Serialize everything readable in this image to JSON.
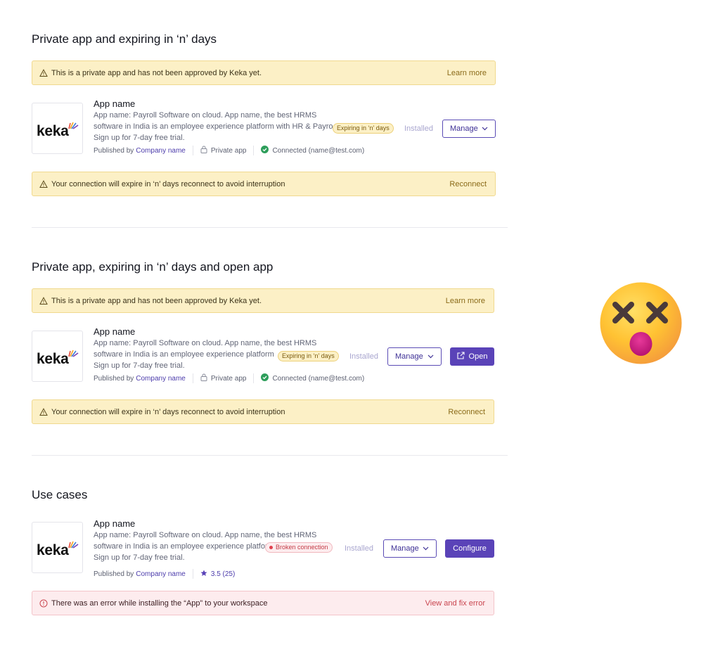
{
  "sections": [
    {
      "title": "Private app and expiring in ‘n’ days",
      "private_banner": {
        "message": "This is a private app and has not been approved by Keka yet.",
        "action": "Learn more"
      },
      "app": {
        "logo_text": "keka",
        "name": "App name",
        "description_lines": [
          "App name: Payroll Software on cloud. App name, the best HRMS",
          "software in India is an employee experience platform with HR & Payroll",
          "Sign up for 7-day free trial."
        ],
        "badge": "Expiring in ‘n’ days",
        "published_by": "Published by",
        "company": "Company name",
        "private_label": "Private app",
        "connected": "Connected (name@test.com)",
        "status": "Installed",
        "manage_label": "Manage"
      },
      "expiry_banner": {
        "message": "Your connection will expire in ‘n’ days reconnect to avoid interruption",
        "action": "Reconnect"
      }
    },
    {
      "title": "Private app, expiring in ‘n’ days and open app",
      "private_banner": {
        "message": "This is a private app and has not been approved by Keka yet.",
        "action": "Learn more"
      },
      "app": {
        "logo_text": "keka",
        "name": "App name",
        "description_lines": [
          "App name: Payroll Software on cloud. App name, the best HRMS",
          "software in India is an employee experience platform",
          "Sign up for 7-day free trial."
        ],
        "badge": "Expiring in ‘n’ days",
        "published_by": "Published by",
        "company": "Company name",
        "private_label": "Private app",
        "connected": "Connected (name@test.com)",
        "status": "Installed",
        "manage_label": "Manage",
        "open_label": "Open"
      },
      "expiry_banner": {
        "message": "Your connection will expire in ‘n’ days reconnect to avoid interruption",
        "action": "Reconnect"
      }
    },
    {
      "title": "Use cases",
      "app": {
        "logo_text": "keka",
        "name": "App name",
        "description_lines": [
          "App name: Payroll Software on cloud. App name, the best HRMS",
          "software in India is an employee experience platform.",
          "Sign up for 7-day free trial."
        ],
        "badge": "Broken connection",
        "published_by": "Published by",
        "company": "Company name",
        "rating": "3.5 (25)",
        "status": "Installed",
        "manage_label": "Manage",
        "configure_label": "Configure"
      },
      "error_banner": {
        "message": "There was an error while installing the “App” to your workspace",
        "action": "View and fix error"
      }
    }
  ],
  "colors": {
    "accent": "#5a43b8",
    "warning_bg": "#fcf0c6",
    "error_bg": "#fdecee",
    "success": "#2e9e5b"
  }
}
